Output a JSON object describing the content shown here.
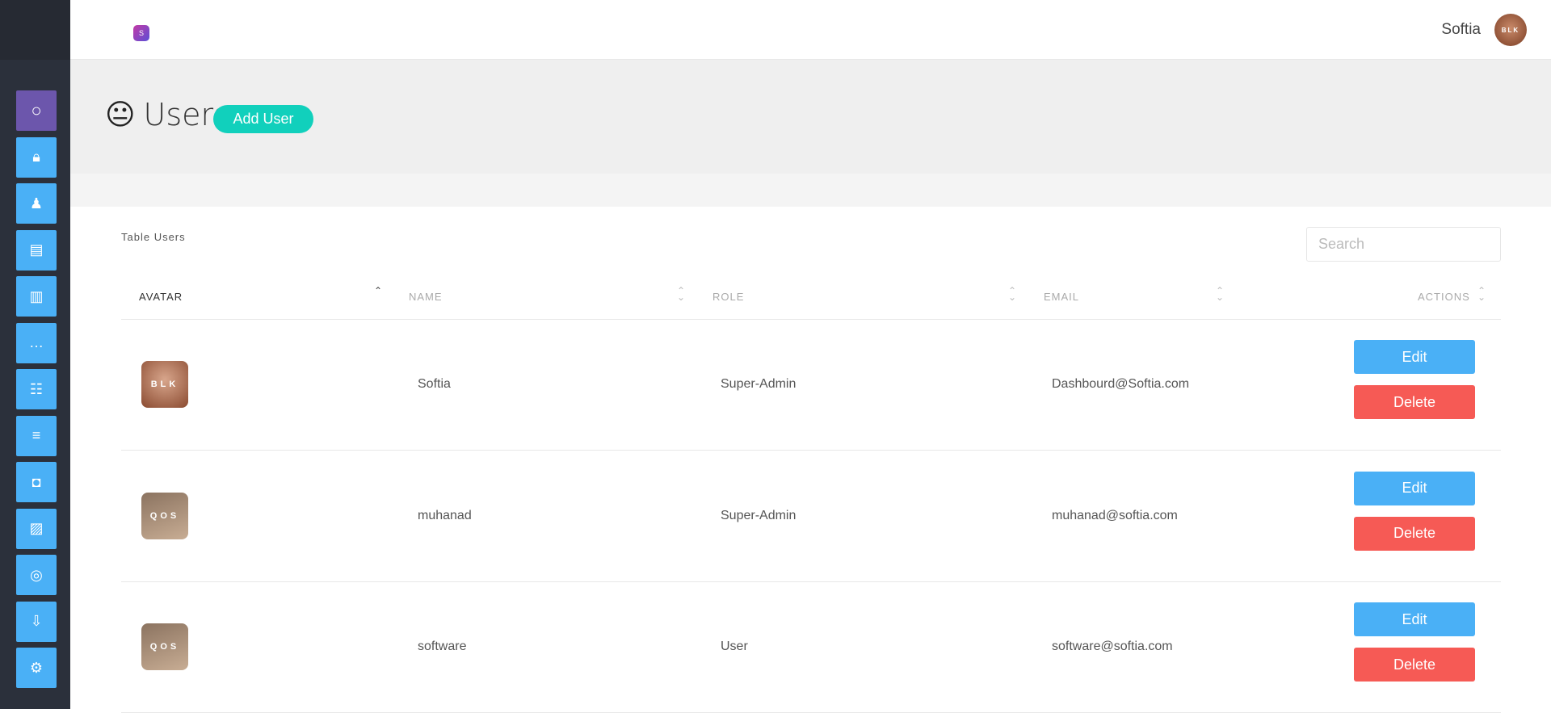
{
  "header": {
    "logo": "S",
    "username": "Softia",
    "avatar_text": "BLK"
  },
  "sidebar": {
    "items": [
      {
        "name": "circle",
        "glyph": "○"
      },
      {
        "name": "lock",
        "glyph": "🔒︎"
      },
      {
        "name": "person",
        "glyph": "♟"
      },
      {
        "name": "newspaper",
        "glyph": "▤"
      },
      {
        "name": "chart",
        "glyph": "▥"
      },
      {
        "name": "message",
        "glyph": "…"
      },
      {
        "name": "list",
        "glyph": "☷"
      },
      {
        "name": "menu",
        "glyph": "≡"
      },
      {
        "name": "camera",
        "glyph": "◘"
      },
      {
        "name": "image",
        "glyph": "▨"
      },
      {
        "name": "instagram",
        "glyph": "◎"
      },
      {
        "name": "inbox",
        "glyph": "⇩"
      },
      {
        "name": "settings",
        "glyph": "⚙"
      }
    ]
  },
  "page": {
    "face": "😐︎",
    "title": "Users",
    "add_label": "Add User"
  },
  "table": {
    "label": "Table Users",
    "search_placeholder": "Search",
    "columns": [
      "AVATAR",
      "NAME",
      "ROLE",
      "EMAIL",
      "ACTIONS"
    ],
    "rows": [
      {
        "avatar": "BLK",
        "name": "Softia",
        "role": "Super-Admin",
        "email": "Dashbourd@Softia.com",
        "edit": "Edit",
        "delete": "Delete"
      },
      {
        "avatar": "QOS",
        "name": "muhanad",
        "role": "Super-Admin",
        "email": "muhanad@softia.com",
        "edit": "Edit",
        "delete": "Delete"
      },
      {
        "avatar": "QOS",
        "name": "software",
        "role": "User",
        "email": "software@softia.com",
        "edit": "Edit",
        "delete": "Delete"
      }
    ]
  },
  "colors": {
    "accent": "#11d0bc",
    "edit": "#4ab0f6",
    "delete": "#f65a55",
    "sidebar": "#2b303b",
    "active": "#6c56ac"
  }
}
